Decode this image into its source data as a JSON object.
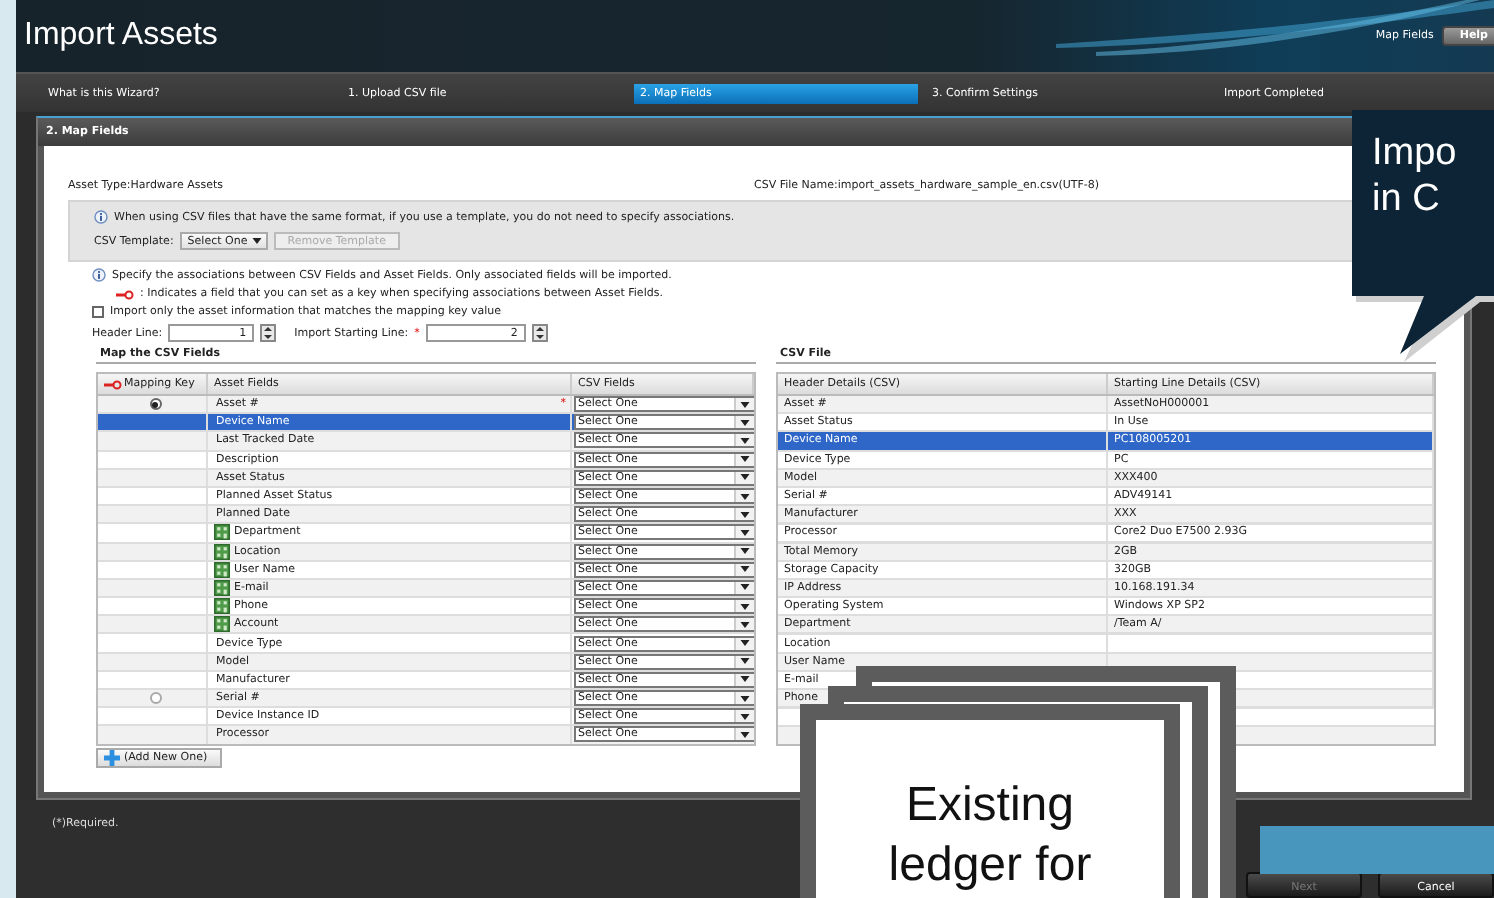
{
  "window": {
    "title": "Import Assets"
  },
  "header_links": {
    "current": "Map Fields",
    "help_button": "Help"
  },
  "steps": [
    {
      "label": "What is this Wizard?",
      "selected": false
    },
    {
      "label": "1. Upload CSV file",
      "selected": false
    },
    {
      "label": "2. Map Fields",
      "selected": true
    },
    {
      "label": "3. Confirm Settings",
      "selected": false
    },
    {
      "label": "Import Completed",
      "selected": false
    }
  ],
  "panel": {
    "title": "2. Map Fields"
  },
  "asset_type": "Asset Type:Hardware Assets",
  "csv_file_name": "CSV File Name:import_assets_hardware_sample_en.csv(UTF-8)",
  "template_box": {
    "info": "When using CSV files that have the same format, if you use a template, you do not need to specify associations.",
    "label": "CSV Template:",
    "select_value": "Select One",
    "remove_button": {
      "label": "Remove Template",
      "disabled": true
    }
  },
  "instructions": {
    "info": "Specify the associations between CSV Fields and Asset Fields. Only associated fields will be imported.",
    "key_note": ": Indicates a field that you can set as a key when specifying associations between Asset Fields.",
    "match_checkbox": {
      "label": "Import only the asset information that matches the mapping key value",
      "checked": false
    }
  },
  "header_line": {
    "label": "Header Line:",
    "value": "1"
  },
  "starting_line": {
    "label": "Import Starting Line:",
    "required_mark": "*",
    "value": "2"
  },
  "mapping": {
    "title": "Map the CSV Fields",
    "columns": [
      "Mapping Key",
      "Asset Fields",
      "CSV Fields"
    ],
    "rows": [
      {
        "field": "Asset #",
        "kind": "field",
        "key_radio": {
          "selected": true
        },
        "required_mark": "*",
        "csv_field": "Select One",
        "selected": false
      },
      {
        "field": "Device Name",
        "kind": "field",
        "csv_field": "Select One",
        "selected": true
      },
      {
        "field": "Last Tracked Date",
        "kind": "field",
        "csv_field": "Select One",
        "selected": false
      },
      {
        "field": "Description",
        "kind": "field",
        "csv_field": "Select One",
        "selected": false
      },
      {
        "field": "Asset Status",
        "kind": "field",
        "csv_field": "Select One",
        "selected": false
      },
      {
        "field": "Planned Asset Status",
        "kind": "field",
        "csv_field": "Select One",
        "selected": false
      },
      {
        "field": "Planned Date",
        "kind": "field",
        "csv_field": "Select One",
        "selected": false
      },
      {
        "field": "Department",
        "kind": "reference",
        "csv_field": "Select One",
        "selected": false
      },
      {
        "field": "Location",
        "kind": "reference",
        "csv_field": "Select One",
        "selected": false
      },
      {
        "field": "User Name",
        "kind": "reference",
        "csv_field": "Select One",
        "selected": false
      },
      {
        "field": "E-mail",
        "kind": "reference",
        "csv_field": "Select One",
        "selected": false
      },
      {
        "field": "Phone",
        "kind": "reference",
        "csv_field": "Select One",
        "selected": false
      },
      {
        "field": "Account",
        "kind": "reference",
        "csv_field": "Select One",
        "selected": false
      },
      {
        "field": "Device Type",
        "kind": "field",
        "csv_field": "Select One",
        "selected": false
      },
      {
        "field": "Model",
        "kind": "field",
        "csv_field": "Select One",
        "selected": false
      },
      {
        "field": "Manufacturer",
        "kind": "field",
        "csv_field": "Select One",
        "selected": false
      },
      {
        "field": "Serial #",
        "kind": "field",
        "key_radio": {
          "selected": false
        },
        "csv_field": "Select One",
        "selected": false
      },
      {
        "field": "Device Instance ID",
        "kind": "field",
        "csv_field": "Select One",
        "selected": false
      },
      {
        "field": "Processor",
        "kind": "field",
        "csv_field": "Select One",
        "selected": false
      }
    ],
    "add_button": "(Add New One)"
  },
  "csv_file": {
    "title": "CSV File",
    "columns": [
      "Header Details (CSV)",
      "Starting Line Details (CSV)"
    ],
    "rows": [
      {
        "header": "Asset #",
        "value": "AssetNoH000001",
        "selected": false
      },
      {
        "header": "Asset Status",
        "value": "In Use",
        "selected": false
      },
      {
        "header": "Device Name",
        "value": "PC108005201",
        "selected": true
      },
      {
        "header": "Device Type",
        "value": "PC",
        "selected": false
      },
      {
        "header": "Model",
        "value": "XXX400",
        "selected": false
      },
      {
        "header": "Serial #",
        "value": "ADV49141",
        "selected": false
      },
      {
        "header": "Manufacturer",
        "value": "XXX",
        "selected": false
      },
      {
        "header": "Processor",
        "value": "Core2 Duo E7500 2.93G",
        "selected": false
      },
      {
        "header": "Total Memory",
        "value": "2GB",
        "selected": false
      },
      {
        "header": "Storage Capacity",
        "value": "320GB",
        "selected": false
      },
      {
        "header": "IP Address",
        "value": "10.168.191.34",
        "selected": false
      },
      {
        "header": "Operating System",
        "value": "Windows XP SP2",
        "selected": false
      },
      {
        "header": "Department",
        "value": "/Team A/",
        "selected": false
      },
      {
        "header": "Location",
        "selected": false
      },
      {
        "header": "User Name",
        "selected": false
      },
      {
        "header": "E-mail",
        "selected": false
      },
      {
        "header": "Phone",
        "selected": false
      }
    ]
  },
  "footer": {
    "required_note": "(*)Required.",
    "buttons": [
      {
        "label": "Next",
        "disabled": true
      },
      {
        "label": "Cancel",
        "disabled": false
      }
    ]
  },
  "callout": {
    "lines": [
      "Impo",
      "in C"
    ]
  },
  "ledger_note": {
    "lines": [
      "Existing",
      "ledger for"
    ]
  }
}
